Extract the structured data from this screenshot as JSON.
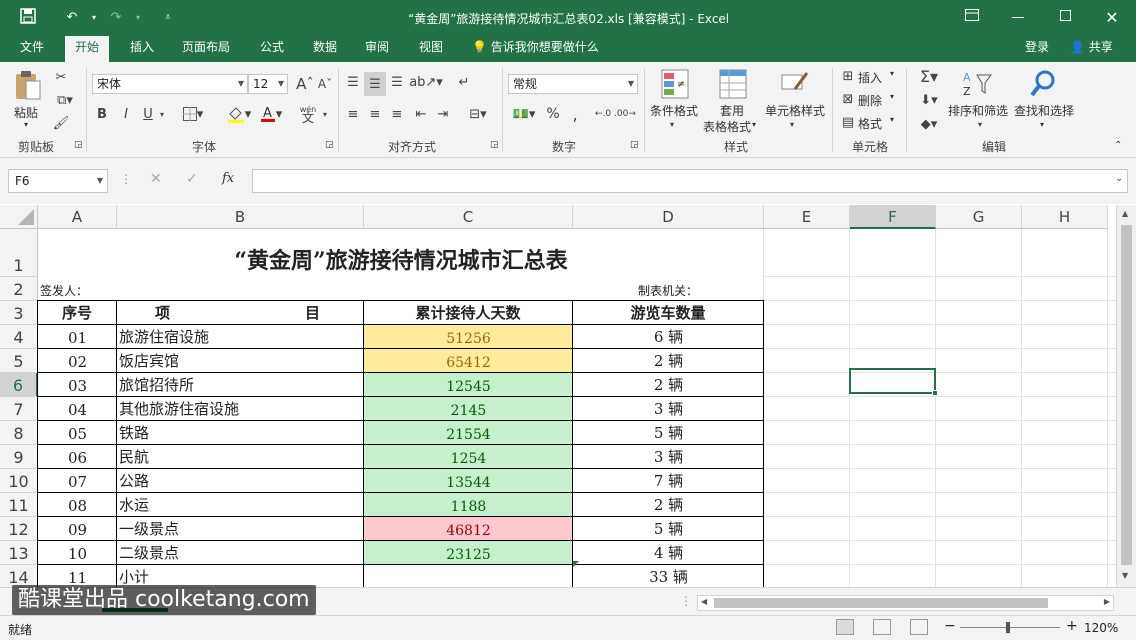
{
  "window": {
    "title": "“黄金周”旅游接待情况城市汇总表02.xls  [兼容模式] - Excel",
    "qat_save_icon": "save-icon",
    "qat_undo_icon": "undo-icon",
    "qat_redo_icon": "redo-icon"
  },
  "menu": {
    "tabs": [
      "文件",
      "开始",
      "插入",
      "页面布局",
      "公式",
      "数据",
      "审阅",
      "视图"
    ],
    "tell_me": "告诉我你想要做什么",
    "login": "登录",
    "share": "共享"
  },
  "ribbon": {
    "clipboard": {
      "paste": "粘贴",
      "label": "剪贴板"
    },
    "font": {
      "name": "宋体",
      "size": "12",
      "bold": "B",
      "italic": "I",
      "underline": "U",
      "label": "字体",
      "wen": "wén",
      "wen_zh": "文"
    },
    "alignment": {
      "label": "对齐方式"
    },
    "number": {
      "format": "常规",
      "label": "数字",
      "percent": "%",
      "comma": ","
    },
    "styles": {
      "conditional": "条件格式",
      "table1": "套用",
      "table2": "表格格式",
      "cell_styles": "单元格样式",
      "label": "样式"
    },
    "cells": {
      "insert": "插入",
      "delete": "删除",
      "format": "格式",
      "label": "单元格"
    },
    "editing": {
      "sort": "排序和筛选",
      "find": "查找和选择",
      "label": "编辑"
    }
  },
  "formula_bar": {
    "name_box": "F6",
    "fx": "fx",
    "content": ""
  },
  "columns": [
    "A",
    "B",
    "C",
    "D",
    "E",
    "F",
    "G",
    "H"
  ],
  "rows": [
    "1",
    "2",
    "3",
    "4",
    "5",
    "6",
    "7",
    "8",
    "9",
    "10",
    "11",
    "12",
    "13",
    "14"
  ],
  "sheet": {
    "title": "“黄金周”旅游接待情况城市汇总表",
    "signer": "签发人：",
    "agency": "制表机关：",
    "headers": {
      "no": "序号",
      "item": "项",
      "item2": "目",
      "total": "累计接待人天数",
      "cars": "游览车数量"
    },
    "records": [
      {
        "no": "01",
        "item": "旅游住宿设施",
        "total": "51256",
        "cars": "6 辆"
      },
      {
        "no": "02",
        "item": "饭店宾馆",
        "total": "65412",
        "cars": "2 辆"
      },
      {
        "no": "03",
        "item": "旅馆招待所",
        "total": "12545",
        "cars": "2 辆"
      },
      {
        "no": "04",
        "item": "其他旅游住宿设施",
        "total": "2145",
        "cars": "3 辆"
      },
      {
        "no": "05",
        "item": "铁路",
        "total": "21554",
        "cars": "5 辆"
      },
      {
        "no": "06",
        "item": "民航",
        "total": "1254",
        "cars": "3 辆"
      },
      {
        "no": "07",
        "item": "公路",
        "total": "13544",
        "cars": "7 辆"
      },
      {
        "no": "08",
        "item": "水运",
        "total": "1188",
        "cars": "2 辆"
      },
      {
        "no": "09",
        "item": "一级景点",
        "total": "46812",
        "cars": "5 辆"
      },
      {
        "no": "10",
        "item": "二级景点",
        "total": "23125",
        "cars": "4 辆"
      },
      {
        "no": "11",
        "item": "小计",
        "total": "",
        "cars": "33 辆"
      }
    ]
  },
  "colors": {
    "excel_green": "#217346",
    "yellow_fill": "#ffeb9c",
    "yellow_text": "#9c6500",
    "green_fill": "#c6efce",
    "green_text": "#006100",
    "red_fill": "#ffc7ce",
    "red_text": "#9c0006"
  },
  "status": {
    "ready": "就绪",
    "zoom": "120%"
  },
  "watermark": "酷课堂出品 coolketang.com"
}
